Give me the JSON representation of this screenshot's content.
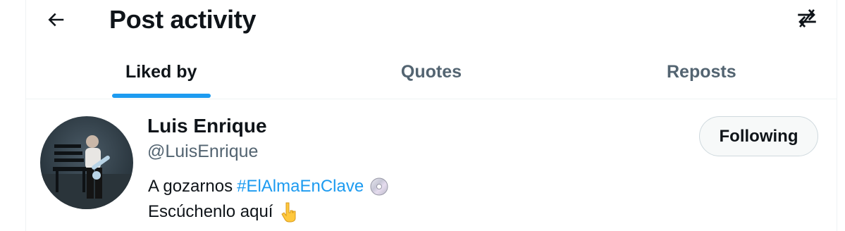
{
  "header": {
    "title": "Post activity",
    "back_icon": "arrow-left-icon",
    "swap_icon": "swap-arrows-icon"
  },
  "tabs": [
    {
      "label": "Liked by",
      "active": true
    },
    {
      "label": "Quotes",
      "active": false
    },
    {
      "label": "Reposts",
      "active": false
    }
  ],
  "user": {
    "name": "Luis Enrique",
    "handle": "@LuisEnrique",
    "follow_label": "Following",
    "bio": {
      "line1_text": "A gozarnos",
      "hashtag": "#ElAlmaEnClave",
      "line1_emoji": "disc-icon",
      "line2_text": "Escúchenlo aquí",
      "line2_emoji": "pointing-down-icon"
    }
  },
  "colors": {
    "accent": "#1d9bf0",
    "text_primary": "#0f1419",
    "text_secondary": "#536471",
    "border": "#eff3f4"
  }
}
